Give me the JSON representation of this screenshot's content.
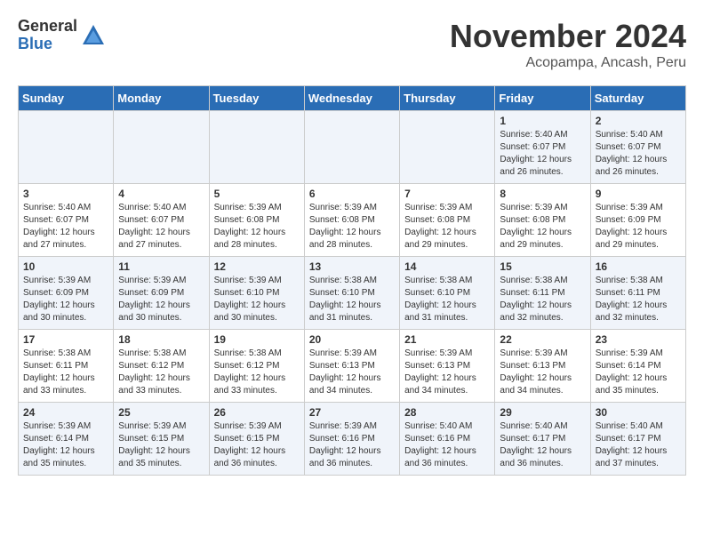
{
  "header": {
    "logo_general": "General",
    "logo_blue": "Blue",
    "month_title": "November 2024",
    "subtitle": "Acopampa, Ancash, Peru"
  },
  "days_of_week": [
    "Sunday",
    "Monday",
    "Tuesday",
    "Wednesday",
    "Thursday",
    "Friday",
    "Saturday"
  ],
  "weeks": [
    [
      {
        "day": "",
        "text": ""
      },
      {
        "day": "",
        "text": ""
      },
      {
        "day": "",
        "text": ""
      },
      {
        "day": "",
        "text": ""
      },
      {
        "day": "",
        "text": ""
      },
      {
        "day": "1",
        "text": "Sunrise: 5:40 AM\nSunset: 6:07 PM\nDaylight: 12 hours and 26 minutes."
      },
      {
        "day": "2",
        "text": "Sunrise: 5:40 AM\nSunset: 6:07 PM\nDaylight: 12 hours and 26 minutes."
      }
    ],
    [
      {
        "day": "3",
        "text": "Sunrise: 5:40 AM\nSunset: 6:07 PM\nDaylight: 12 hours and 27 minutes."
      },
      {
        "day": "4",
        "text": "Sunrise: 5:40 AM\nSunset: 6:07 PM\nDaylight: 12 hours and 27 minutes."
      },
      {
        "day": "5",
        "text": "Sunrise: 5:39 AM\nSunset: 6:08 PM\nDaylight: 12 hours and 28 minutes."
      },
      {
        "day": "6",
        "text": "Sunrise: 5:39 AM\nSunset: 6:08 PM\nDaylight: 12 hours and 28 minutes."
      },
      {
        "day": "7",
        "text": "Sunrise: 5:39 AM\nSunset: 6:08 PM\nDaylight: 12 hours and 29 minutes."
      },
      {
        "day": "8",
        "text": "Sunrise: 5:39 AM\nSunset: 6:08 PM\nDaylight: 12 hours and 29 minutes."
      },
      {
        "day": "9",
        "text": "Sunrise: 5:39 AM\nSunset: 6:09 PM\nDaylight: 12 hours and 29 minutes."
      }
    ],
    [
      {
        "day": "10",
        "text": "Sunrise: 5:39 AM\nSunset: 6:09 PM\nDaylight: 12 hours and 30 minutes."
      },
      {
        "day": "11",
        "text": "Sunrise: 5:39 AM\nSunset: 6:09 PM\nDaylight: 12 hours and 30 minutes."
      },
      {
        "day": "12",
        "text": "Sunrise: 5:39 AM\nSunset: 6:10 PM\nDaylight: 12 hours and 30 minutes."
      },
      {
        "day": "13",
        "text": "Sunrise: 5:38 AM\nSunset: 6:10 PM\nDaylight: 12 hours and 31 minutes."
      },
      {
        "day": "14",
        "text": "Sunrise: 5:38 AM\nSunset: 6:10 PM\nDaylight: 12 hours and 31 minutes."
      },
      {
        "day": "15",
        "text": "Sunrise: 5:38 AM\nSunset: 6:11 PM\nDaylight: 12 hours and 32 minutes."
      },
      {
        "day": "16",
        "text": "Sunrise: 5:38 AM\nSunset: 6:11 PM\nDaylight: 12 hours and 32 minutes."
      }
    ],
    [
      {
        "day": "17",
        "text": "Sunrise: 5:38 AM\nSunset: 6:11 PM\nDaylight: 12 hours and 33 minutes."
      },
      {
        "day": "18",
        "text": "Sunrise: 5:38 AM\nSunset: 6:12 PM\nDaylight: 12 hours and 33 minutes."
      },
      {
        "day": "19",
        "text": "Sunrise: 5:38 AM\nSunset: 6:12 PM\nDaylight: 12 hours and 33 minutes."
      },
      {
        "day": "20",
        "text": "Sunrise: 5:39 AM\nSunset: 6:13 PM\nDaylight: 12 hours and 34 minutes."
      },
      {
        "day": "21",
        "text": "Sunrise: 5:39 AM\nSunset: 6:13 PM\nDaylight: 12 hours and 34 minutes."
      },
      {
        "day": "22",
        "text": "Sunrise: 5:39 AM\nSunset: 6:13 PM\nDaylight: 12 hours and 34 minutes."
      },
      {
        "day": "23",
        "text": "Sunrise: 5:39 AM\nSunset: 6:14 PM\nDaylight: 12 hours and 35 minutes."
      }
    ],
    [
      {
        "day": "24",
        "text": "Sunrise: 5:39 AM\nSunset: 6:14 PM\nDaylight: 12 hours and 35 minutes."
      },
      {
        "day": "25",
        "text": "Sunrise: 5:39 AM\nSunset: 6:15 PM\nDaylight: 12 hours and 35 minutes."
      },
      {
        "day": "26",
        "text": "Sunrise: 5:39 AM\nSunset: 6:15 PM\nDaylight: 12 hours and 36 minutes."
      },
      {
        "day": "27",
        "text": "Sunrise: 5:39 AM\nSunset: 6:16 PM\nDaylight: 12 hours and 36 minutes."
      },
      {
        "day": "28",
        "text": "Sunrise: 5:40 AM\nSunset: 6:16 PM\nDaylight: 12 hours and 36 minutes."
      },
      {
        "day": "29",
        "text": "Sunrise: 5:40 AM\nSunset: 6:17 PM\nDaylight: 12 hours and 36 minutes."
      },
      {
        "day": "30",
        "text": "Sunrise: 5:40 AM\nSunset: 6:17 PM\nDaylight: 12 hours and 37 minutes."
      }
    ]
  ]
}
